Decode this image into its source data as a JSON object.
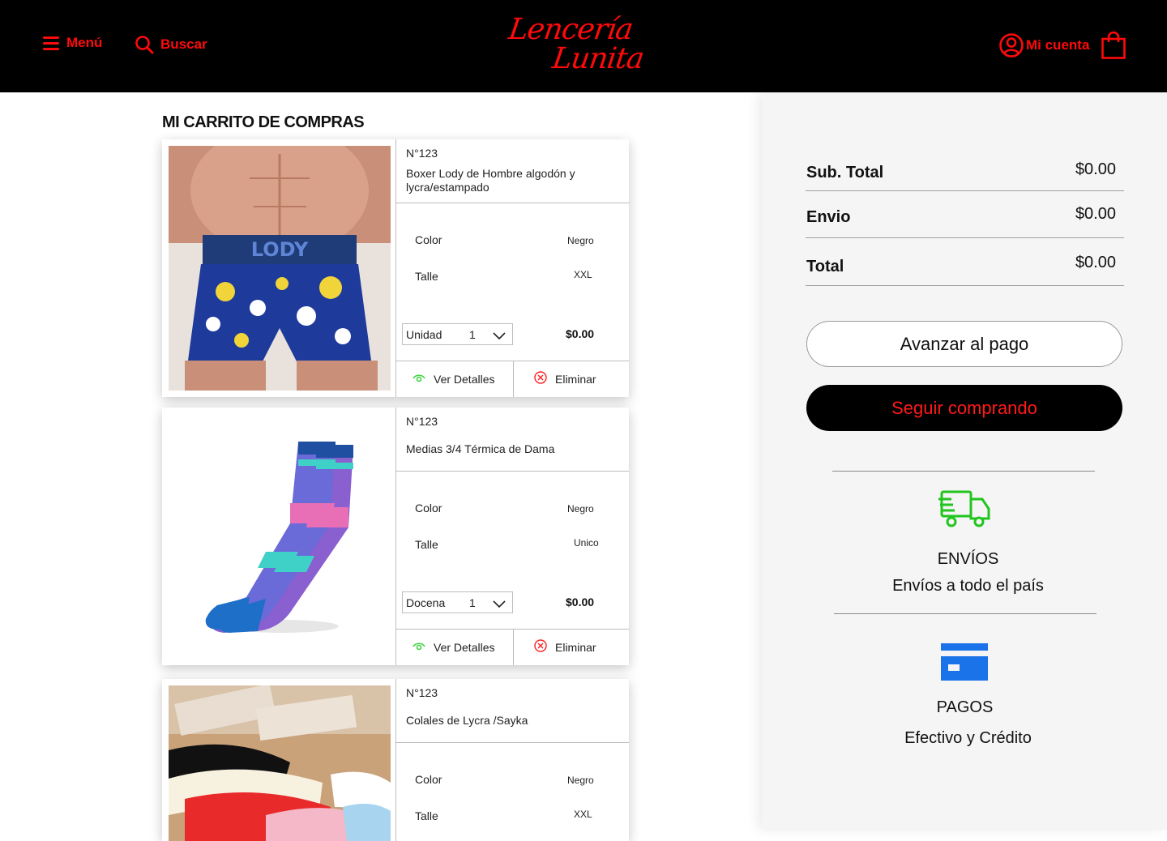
{
  "header": {
    "menu_label": "Menú",
    "search_label": "Buscar",
    "logo_line1": "Lencería",
    "logo_line2": "Lunita",
    "account_label": "Mi cuenta",
    "accent_color": "#ff0a0a"
  },
  "cart": {
    "title": "MI CARRITO DE COMPRAS",
    "items": [
      {
        "code": "N°123",
        "name": "Boxer Lody  de Hombre algodón y lycra/estampado",
        "color_label": "Color",
        "color_value": "Negro",
        "size_label": "Talle",
        "size_value": "XXL",
        "unit": "Unidad",
        "quantity": "1",
        "price": "$0.00",
        "details_label": "Ver Detalles",
        "remove_label": "Eliminar"
      },
      {
        "code": "N°123",
        "name": "Medias 3/4 Térmica de Dama",
        "color_label": "Color",
        "color_value": "Negro",
        "size_label": "Talle",
        "size_value": "Unico",
        "unit": "Docena",
        "quantity": "1",
        "price": "$0.00",
        "details_label": "Ver Detalles",
        "remove_label": "Eliminar"
      },
      {
        "code": "N°123",
        "name": "Colales de Lycra /Sayka",
        "color_label": "Color",
        "color_value": "Negro",
        "size_label": "Talle",
        "size_value": "XXL"
      }
    ]
  },
  "summary": {
    "subtotal_label": "Sub. Total",
    "subtotal_value": "$0.00",
    "shipping_label": "Envio",
    "shipping_value": "$0.00",
    "total_label": "Total",
    "total_value": "$0.00",
    "pay_button": "Avanzar al pago",
    "continue_button": "Seguir comprando",
    "shipping_feature_title": "ENVÍOS",
    "shipping_feature_text": "Envíos a todo el país",
    "payments_feature_title": "PAGOS",
    "payments_feature_text": "Efectivo y Crédito",
    "truck_icon_color": "#22c51e",
    "card_icon_color": "#1a73e8"
  }
}
